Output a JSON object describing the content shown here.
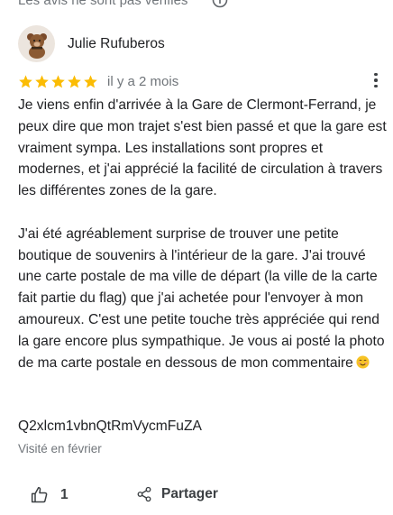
{
  "header_note": "Les avis ne sont pas vérifiés",
  "author": {
    "name": "Julie Rufuberos",
    "avatar_icon": "teddy-bear-avatar"
  },
  "rating": {
    "stars": 5,
    "max_stars": 5,
    "star_color": "#fbbc04",
    "date": "il y a 2 mois"
  },
  "review": {
    "paragraph_1": "Je viens enfin d'arrivée à la Gare de Clermont-Ferrand, je peux dire que mon trajet s'est bien passé et que la gare est vraiment sympa. Les installations sont propres et modernes, et j'ai apprécié la facilité de circulation à travers les différentes zones de la gare.",
    "paragraph_2": "J'ai été agréablement surprise de trouver une petite boutique de souvenirs à l'intérieur de la gare. J'ai trouvé une carte postale de ma ville de départ (la ville de la carte fait partie du flag) que j'ai achetée pour l'envoyer à mon amoureux. C'est une petite touche très appréciée qui rend la gare encore plus sympathique. Je vous ai posté la photo de ma carte postale en dessous de mon commentaire",
    "emoji_icon": "smiling-face-emoji"
  },
  "code_text": "Q2xlcm1vbnQtRmVycmFuZA",
  "visited": "Visité en février",
  "actions": {
    "like_count": "1",
    "share_label": "Partager"
  }
}
